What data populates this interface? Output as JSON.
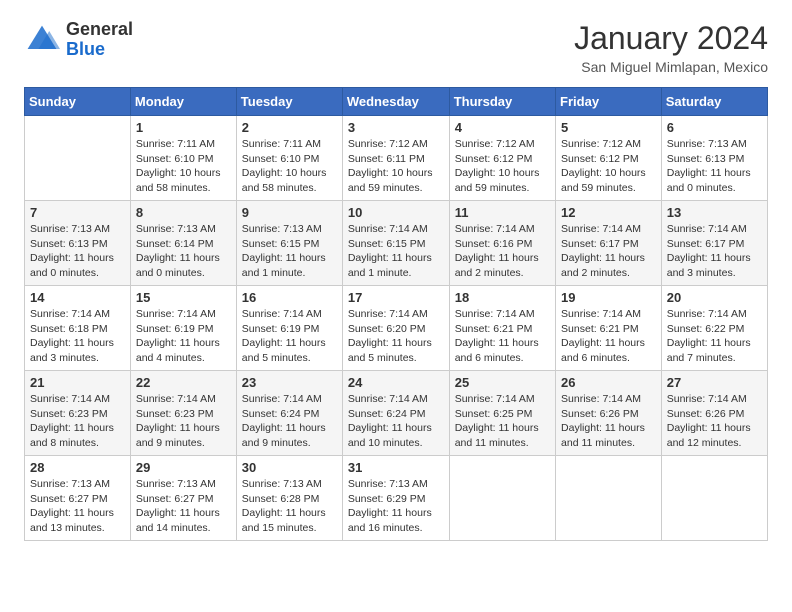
{
  "header": {
    "logo_general": "General",
    "logo_blue": "Blue",
    "month_year": "January 2024",
    "location": "San Miguel Mimlapan, Mexico"
  },
  "columns": [
    "Sunday",
    "Monday",
    "Tuesday",
    "Wednesday",
    "Thursday",
    "Friday",
    "Saturday"
  ],
  "weeks": [
    [
      {
        "day": "",
        "sunrise": "",
        "sunset": "",
        "daylight": ""
      },
      {
        "day": "1",
        "sunrise": "Sunrise: 7:11 AM",
        "sunset": "Sunset: 6:10 PM",
        "daylight": "Daylight: 10 hours and 58 minutes."
      },
      {
        "day": "2",
        "sunrise": "Sunrise: 7:11 AM",
        "sunset": "Sunset: 6:10 PM",
        "daylight": "Daylight: 10 hours and 58 minutes."
      },
      {
        "day": "3",
        "sunrise": "Sunrise: 7:12 AM",
        "sunset": "Sunset: 6:11 PM",
        "daylight": "Daylight: 10 hours and 59 minutes."
      },
      {
        "day": "4",
        "sunrise": "Sunrise: 7:12 AM",
        "sunset": "Sunset: 6:12 PM",
        "daylight": "Daylight: 10 hours and 59 minutes."
      },
      {
        "day": "5",
        "sunrise": "Sunrise: 7:12 AM",
        "sunset": "Sunset: 6:12 PM",
        "daylight": "Daylight: 10 hours and 59 minutes."
      },
      {
        "day": "6",
        "sunrise": "Sunrise: 7:13 AM",
        "sunset": "Sunset: 6:13 PM",
        "daylight": "Daylight: 11 hours and 0 minutes."
      }
    ],
    [
      {
        "day": "7",
        "sunrise": "Sunrise: 7:13 AM",
        "sunset": "Sunset: 6:13 PM",
        "daylight": "Daylight: 11 hours and 0 minutes."
      },
      {
        "day": "8",
        "sunrise": "Sunrise: 7:13 AM",
        "sunset": "Sunset: 6:14 PM",
        "daylight": "Daylight: 11 hours and 0 minutes."
      },
      {
        "day": "9",
        "sunrise": "Sunrise: 7:13 AM",
        "sunset": "Sunset: 6:15 PM",
        "daylight": "Daylight: 11 hours and 1 minute."
      },
      {
        "day": "10",
        "sunrise": "Sunrise: 7:14 AM",
        "sunset": "Sunset: 6:15 PM",
        "daylight": "Daylight: 11 hours and 1 minute."
      },
      {
        "day": "11",
        "sunrise": "Sunrise: 7:14 AM",
        "sunset": "Sunset: 6:16 PM",
        "daylight": "Daylight: 11 hours and 2 minutes."
      },
      {
        "day": "12",
        "sunrise": "Sunrise: 7:14 AM",
        "sunset": "Sunset: 6:17 PM",
        "daylight": "Daylight: 11 hours and 2 minutes."
      },
      {
        "day": "13",
        "sunrise": "Sunrise: 7:14 AM",
        "sunset": "Sunset: 6:17 PM",
        "daylight": "Daylight: 11 hours and 3 minutes."
      }
    ],
    [
      {
        "day": "14",
        "sunrise": "Sunrise: 7:14 AM",
        "sunset": "Sunset: 6:18 PM",
        "daylight": "Daylight: 11 hours and 3 minutes."
      },
      {
        "day": "15",
        "sunrise": "Sunrise: 7:14 AM",
        "sunset": "Sunset: 6:19 PM",
        "daylight": "Daylight: 11 hours and 4 minutes."
      },
      {
        "day": "16",
        "sunrise": "Sunrise: 7:14 AM",
        "sunset": "Sunset: 6:19 PM",
        "daylight": "Daylight: 11 hours and 5 minutes."
      },
      {
        "day": "17",
        "sunrise": "Sunrise: 7:14 AM",
        "sunset": "Sunset: 6:20 PM",
        "daylight": "Daylight: 11 hours and 5 minutes."
      },
      {
        "day": "18",
        "sunrise": "Sunrise: 7:14 AM",
        "sunset": "Sunset: 6:21 PM",
        "daylight": "Daylight: 11 hours and 6 minutes."
      },
      {
        "day": "19",
        "sunrise": "Sunrise: 7:14 AM",
        "sunset": "Sunset: 6:21 PM",
        "daylight": "Daylight: 11 hours and 6 minutes."
      },
      {
        "day": "20",
        "sunrise": "Sunrise: 7:14 AM",
        "sunset": "Sunset: 6:22 PM",
        "daylight": "Daylight: 11 hours and 7 minutes."
      }
    ],
    [
      {
        "day": "21",
        "sunrise": "Sunrise: 7:14 AM",
        "sunset": "Sunset: 6:23 PM",
        "daylight": "Daylight: 11 hours and 8 minutes."
      },
      {
        "day": "22",
        "sunrise": "Sunrise: 7:14 AM",
        "sunset": "Sunset: 6:23 PM",
        "daylight": "Daylight: 11 hours and 9 minutes."
      },
      {
        "day": "23",
        "sunrise": "Sunrise: 7:14 AM",
        "sunset": "Sunset: 6:24 PM",
        "daylight": "Daylight: 11 hours and 9 minutes."
      },
      {
        "day": "24",
        "sunrise": "Sunrise: 7:14 AM",
        "sunset": "Sunset: 6:24 PM",
        "daylight": "Daylight: 11 hours and 10 minutes."
      },
      {
        "day": "25",
        "sunrise": "Sunrise: 7:14 AM",
        "sunset": "Sunset: 6:25 PM",
        "daylight": "Daylight: 11 hours and 11 minutes."
      },
      {
        "day": "26",
        "sunrise": "Sunrise: 7:14 AM",
        "sunset": "Sunset: 6:26 PM",
        "daylight": "Daylight: 11 hours and 11 minutes."
      },
      {
        "day": "27",
        "sunrise": "Sunrise: 7:14 AM",
        "sunset": "Sunset: 6:26 PM",
        "daylight": "Daylight: 11 hours and 12 minutes."
      }
    ],
    [
      {
        "day": "28",
        "sunrise": "Sunrise: 7:13 AM",
        "sunset": "Sunset: 6:27 PM",
        "daylight": "Daylight: 11 hours and 13 minutes."
      },
      {
        "day": "29",
        "sunrise": "Sunrise: 7:13 AM",
        "sunset": "Sunset: 6:27 PM",
        "daylight": "Daylight: 11 hours and 14 minutes."
      },
      {
        "day": "30",
        "sunrise": "Sunrise: 7:13 AM",
        "sunset": "Sunset: 6:28 PM",
        "daylight": "Daylight: 11 hours and 15 minutes."
      },
      {
        "day": "31",
        "sunrise": "Sunrise: 7:13 AM",
        "sunset": "Sunset: 6:29 PM",
        "daylight": "Daylight: 11 hours and 16 minutes."
      },
      {
        "day": "",
        "sunrise": "",
        "sunset": "",
        "daylight": ""
      },
      {
        "day": "",
        "sunrise": "",
        "sunset": "",
        "daylight": ""
      },
      {
        "day": "",
        "sunrise": "",
        "sunset": "",
        "daylight": ""
      }
    ]
  ]
}
